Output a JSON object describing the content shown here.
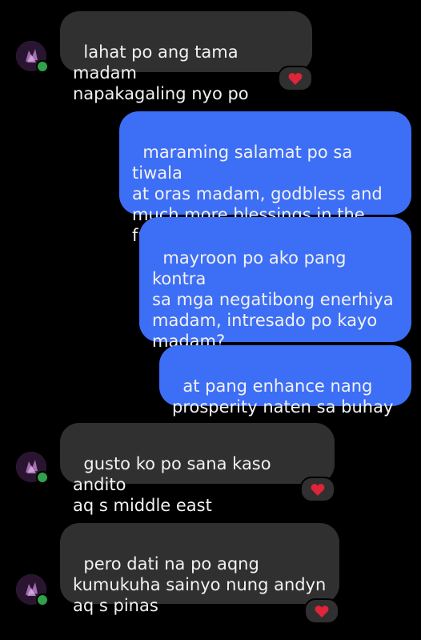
{
  "colors": {
    "background": "#000000",
    "incoming_bubble": "#303030",
    "outgoing_bubble": "#3d6ef6",
    "text": "#f2f2f2",
    "heart": "#e0243a",
    "presence": "#31a24c"
  },
  "messages": [
    {
      "direction": "incoming",
      "text": "lahat po ang tama madam\nnapakagaling nyo po",
      "reaction": "heart-icon"
    },
    {
      "direction": "outgoing",
      "text": "maraming salamat po sa tiwala\nat oras madam, godbless and\nmuch more blessings in the\nfuture",
      "emojis": "🥰🙏"
    },
    {
      "direction": "outgoing",
      "text": "mayroon po ako pang kontra\nsa mga negatibong enerhiya\nmadam, intresado po kayo\nmadam?"
    },
    {
      "direction": "outgoing",
      "text": "at pang enhance nang\nprosperity naten sa buhay"
    },
    {
      "direction": "incoming",
      "text": "gusto ko po sana kaso andito\naq s middle east",
      "reaction": "heart-icon"
    },
    {
      "direction": "incoming",
      "text": "pero dati na po aqng\nkumukuha sainyo nung andyn\naq s pinas",
      "reaction": "heart-icon"
    }
  ]
}
